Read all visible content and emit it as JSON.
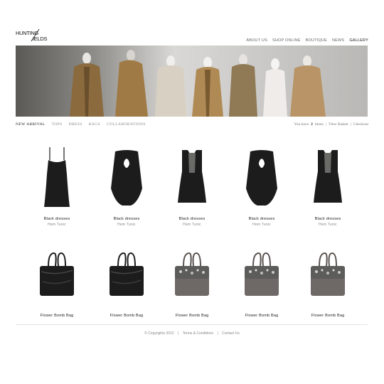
{
  "brand": {
    "logo_text": "HUNTING FIELDS"
  },
  "topnav": [
    {
      "label": "ABOUT US"
    },
    {
      "label": "SHOP ONLINE"
    },
    {
      "label": "BOUTIQUE"
    },
    {
      "label": "NEWS"
    },
    {
      "label": "GALLERY"
    }
  ],
  "subnav": [
    {
      "label": "NEW ARRIVAL"
    },
    {
      "label": "TOPS"
    },
    {
      "label": "DRESS"
    },
    {
      "label": "BAGS"
    },
    {
      "label": "COLLABORATIONS"
    }
  ],
  "basket": {
    "prefix": "You have",
    "count": "2",
    "suffix": "items",
    "sep1": "|",
    "view_label": "View Basket",
    "sep2": "|",
    "checkout_label": "Checkout"
  },
  "products": {
    "dresses": [
      {
        "name": "Black dresses",
        "sub": "Hem Tunic",
        "icon": "dress-strap"
      },
      {
        "name": "Black dresses",
        "sub": "Hem Tunic",
        "icon": "dress-drape"
      },
      {
        "name": "Black dresses",
        "sub": "Hem Tunic",
        "icon": "dress-sheer"
      },
      {
        "name": "Black dresses",
        "sub": "Hem Tunic",
        "icon": "dress-drape"
      },
      {
        "name": "Black dresses",
        "sub": "Hem Tunic",
        "icon": "dress-sheer"
      }
    ],
    "bags": [
      {
        "name": "Flower Bomb Bag",
        "icon": "bag-black"
      },
      {
        "name": "Flower Bomb Bag",
        "icon": "bag-black"
      },
      {
        "name": "Flower Bomb Bag",
        "icon": "bag-grey"
      },
      {
        "name": "Flower Bomb Bag",
        "icon": "bag-grey"
      },
      {
        "name": "Flower Bomb Bag",
        "icon": "bag-grey"
      }
    ]
  },
  "footer": {
    "copyright": "© Copyrights 2012",
    "sep1": "|",
    "terms": "Terms & Conditions",
    "sep2": "|",
    "contact": "Contact Us"
  },
  "colors": {
    "text": "#333333",
    "muted": "#888888",
    "black_item": "#1c1c1c",
    "grey_bag": "#6e6866"
  }
}
